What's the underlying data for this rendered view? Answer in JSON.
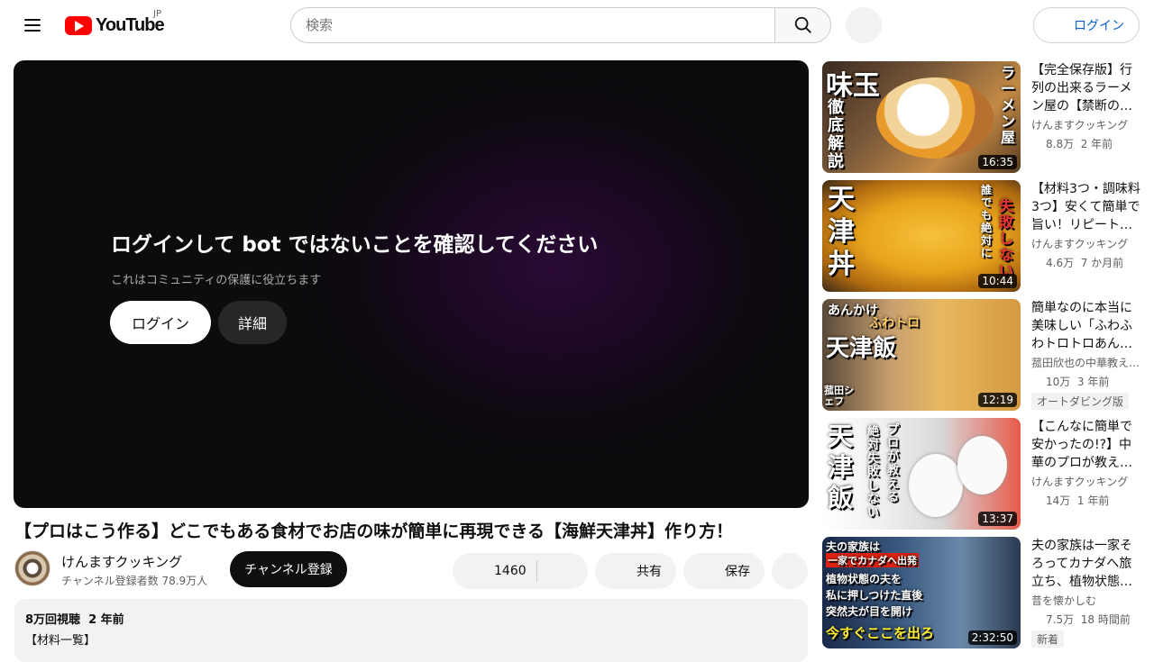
{
  "header": {
    "logo_text": "YouTube",
    "region": "JP",
    "search_placeholder": "検索",
    "signin_label": "ログイン"
  },
  "player": {
    "title": "ログインして bot ではないことを確認してください",
    "subtitle": "これはコミュニティの保護に役立ちます",
    "login_button": "ログイン",
    "more_button": "詳細"
  },
  "video": {
    "title": "【プロはこう作る】どこでもある食材でお店の味が簡単に再現できる【海鮮天津丼】作り方！",
    "channel_name": "けんますクッキング",
    "channel_subs": "チャンネル登録者数 78.9万人",
    "subscribe_label": "チャンネル登録",
    "like_count": "1460",
    "share_label": "共有",
    "save_label": "保存",
    "views": "8万回視聴",
    "age": "2 年前",
    "desc_line": "【材料一覧】"
  },
  "related": [
    {
      "title": "【完全保存版】行列の出来るラーメン屋の【禁断の…",
      "channel": "けんますクッキング",
      "views": "8.8万",
      "age": "2 年前",
      "duration": "16:35",
      "thumb_texts": [
        "味玉",
        "徹底解説",
        "ラーメン屋"
      ],
      "badge": ""
    },
    {
      "title": "【材料3つ・調味料3つ】安くて簡単で旨い！リピート…",
      "channel": "けんますクッキング",
      "views": "4.6万",
      "age": "7 か月前",
      "duration": "10:44",
      "thumb_texts": [
        "天津丼",
        "誰でも絶対に",
        "失敗しない"
      ],
      "badge": ""
    },
    {
      "title": "簡単なのに本当に美味しい「ふわふわトロトロあん…",
      "channel": "菰田欣也の中華教え…",
      "views": "10万",
      "age": "3 年前",
      "duration": "12:19",
      "thumb_texts": [
        "あんかけ",
        "ふわトロ",
        "天津飯",
        "菰田シェフ"
      ],
      "badge": "オートダビング版"
    },
    {
      "title": "【こんなに簡単で安かったの!?】中華のプロが教え…",
      "channel": "けんますクッキング",
      "views": "14万",
      "age": "1 年前",
      "duration": "13:37",
      "thumb_texts": [
        "天津飯",
        "プロが教える",
        "絶対失敗しない"
      ],
      "badge": ""
    },
    {
      "title": "夫の家族は一家そろってカナダへ旅立ち、植物状態…",
      "channel": "昔を懐かしむ",
      "views": "7.5万",
      "age": "18 時間前",
      "duration": "2:32:50",
      "thumb_texts": [
        "夫の家族は",
        "一家でカナダへ出発",
        "植物状態の夫を",
        "私に押しつけた直後",
        "突然夫が目を開け",
        "今すぐここを出ろ"
      ],
      "badge": "新着"
    }
  ]
}
